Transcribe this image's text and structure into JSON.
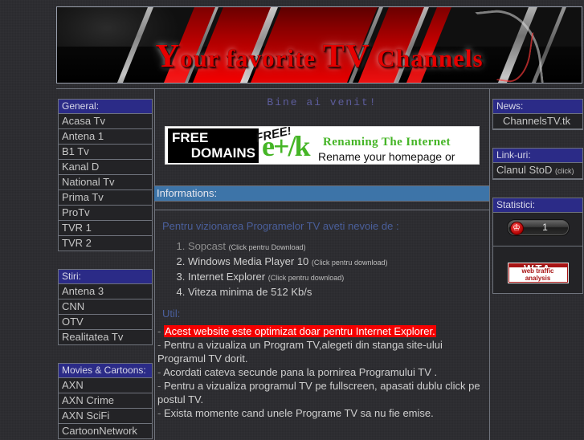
{
  "site": {
    "title_first_letter": "Y",
    "title_rest": "our  favorite  ",
    "title_tv": "TV",
    "title_tail": "  Channels",
    "title_full": "Your favorite TV Channels"
  },
  "center": {
    "welcome": "Bine ai venit!",
    "banner": {
      "free_line1": "FREE",
      "free_line2": "DOMAINS",
      "free_badge": "FREE!",
      "logo_text": "e+/k",
      "tagline_green": "Renaming The Internet",
      "tagline_black": "Rename your homepage or blog"
    },
    "informations_header": "Informations:",
    "lead": "Pentru vizionarea Programelor TV aveti nevoie de :",
    "requirements": [
      {
        "name": "Sopcast",
        "note": "(Click pentru Download)"
      },
      {
        "name": "Windows Media Player 10",
        "note": "(Click pentru download)"
      },
      {
        "name": "Internet Explorer",
        "note": "(Click pentru download)"
      },
      {
        "name": "Viteza minima de 512 Kb/s",
        "note": ""
      }
    ],
    "util_header": "Util:",
    "notes": {
      "highlighted": "Acest website este optimizat doar pentru Internet Explorer.",
      "n2": "Pentru a vizualiza un Program TV,alegeti din stanga site-ului Programul TV dorit.",
      "n3": "Acordati cateva secunde pana la pornirea Programului TV .",
      "n4": "Pentru a vizualiza programul TV pe fullscreen, apasati dublu click pe postul TV.",
      "n5": "Exista momente cand unele Programe TV sa nu fie emise.",
      "dash": "-"
    }
  },
  "sidebar_left": {
    "sections": [
      {
        "header": "General:",
        "items": [
          "Acasa Tv",
          "Antena 1",
          "B1 Tv",
          "Kanal D",
          "National Tv",
          "Prima Tv",
          "ProTv",
          "TVR 1",
          "TVR 2"
        ]
      },
      {
        "header": "Stiri:",
        "items": [
          "Antena 3",
          "CNN",
          "OTV",
          "Realitatea Tv"
        ]
      },
      {
        "header": "Movies & Cartoons:",
        "items": [
          "AXN",
          "AXN Crime",
          "AXN SciFi",
          "CartoonNetwork"
        ]
      }
    ]
  },
  "sidebar_right": {
    "news": {
      "header": "News:",
      "items": [
        "ChannelsTV.tk"
      ]
    },
    "links": {
      "header": "Link-uri:",
      "items": [
        {
          "label": "Clanul StoD",
          "note": "(click)"
        }
      ]
    },
    "stats": {
      "header": "Statistici:",
      "counter_value": "1",
      "counter_icon": "walking-person-icon",
      "wta_title": "WTA",
      "wta_subtitle": "web traffic analysis"
    }
  },
  "colors": {
    "page_bg": "#2c2c30",
    "box_bg": "#232326",
    "border": "#6f737c",
    "section_header": "#2b2b87",
    "info_header": "#3d74a8",
    "accent_red": "#e60000",
    "highlight_red": "#f50000",
    "welcome_text": "#5d5d9c",
    "lead_text": "#4a5f9b",
    "wta_red": "#a71414",
    "banner_green": "#45b526"
  }
}
